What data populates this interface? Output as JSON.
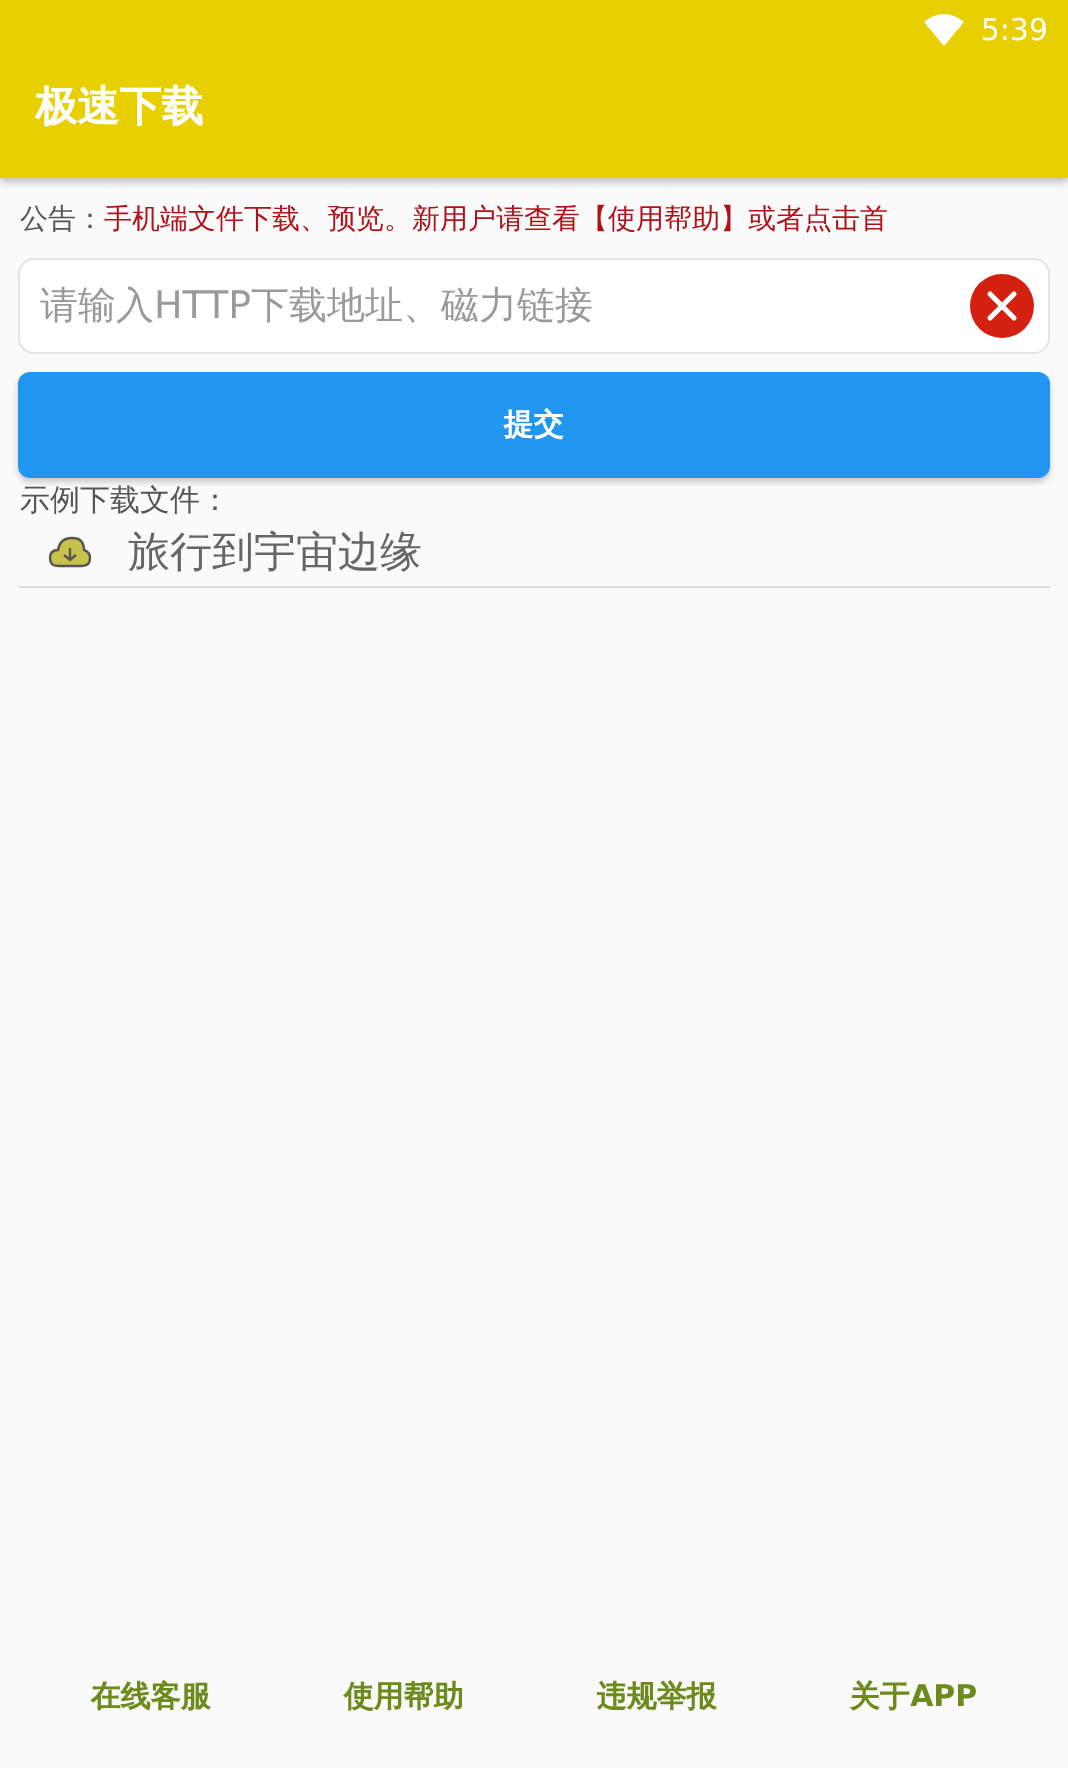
{
  "status_bar": {
    "time": "5:39"
  },
  "app_bar": {
    "title": "极速下载"
  },
  "notice": {
    "label": "公告：",
    "text": "手机端文件下载、预览。新用户请查看【使用帮助】或者点击首"
  },
  "url_field": {
    "placeholder": "请输入HTTP下载地址、磁力链接"
  },
  "submit_button": "提交",
  "examples": {
    "heading": "示例下载文件：",
    "items": [
      {
        "title": "旅行到宇宙边缘"
      }
    ]
  },
  "bottom_links": [
    "在线客服",
    "使用帮助",
    "违规举报",
    "关于APP"
  ]
}
